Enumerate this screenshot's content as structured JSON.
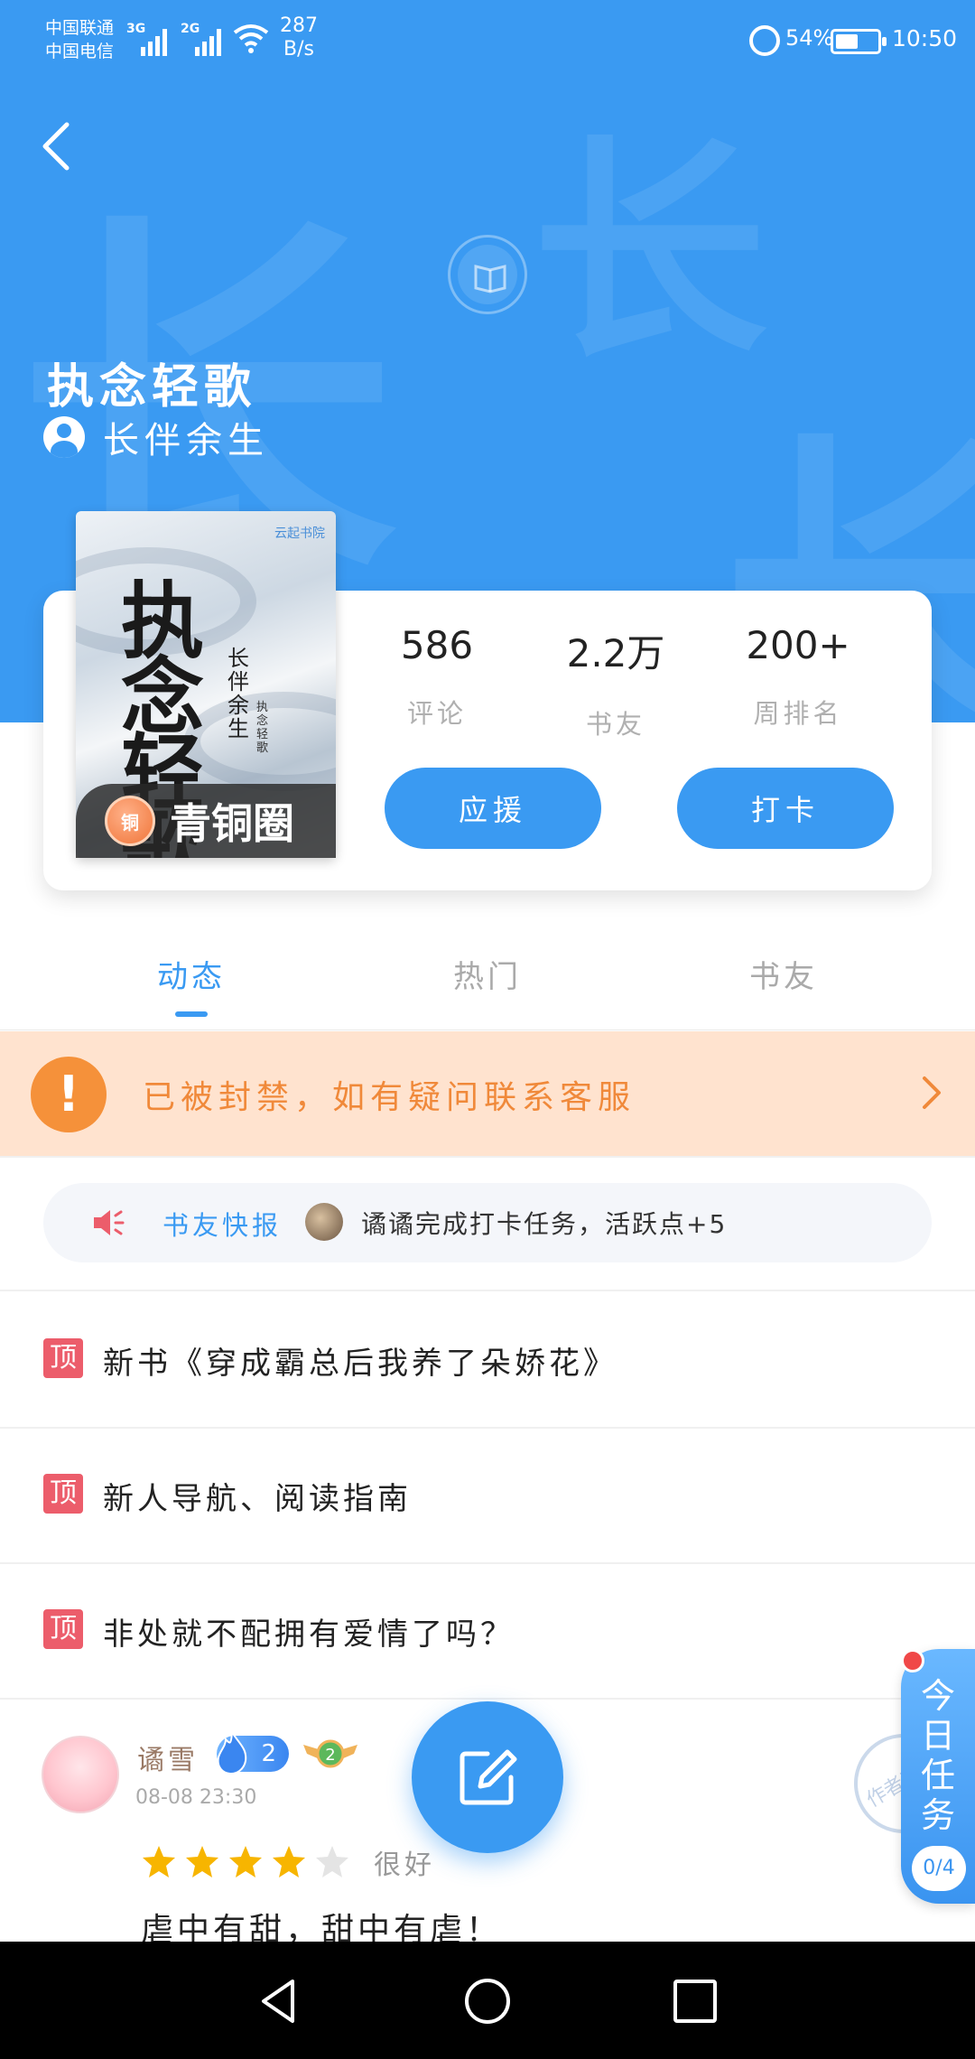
{
  "status_bar": {
    "carrier_1": "中国联通",
    "carrier_2": "中国电信",
    "signal_1": "3G",
    "signal_2": "2G",
    "net_speed_value": "287",
    "net_speed_unit": "B/s",
    "battery": "54%",
    "battery_level": 0.54,
    "time": "10:50"
  },
  "header": {
    "book_title": "执念轻歌",
    "author": "长伴余生",
    "bg_glyph": "长"
  },
  "cover": {
    "title": "执念轻歌",
    "author": "长伴余生",
    "logo": "云起书院",
    "small_text": "执念轻歌",
    "tier_icon_label": "铜",
    "tier_label": "青铜圈"
  },
  "stats": [
    {
      "value": "586",
      "label": "评论"
    },
    {
      "value": "2.2万",
      "label": "书友"
    },
    {
      "value": "200+",
      "label": "周排名"
    }
  ],
  "actions": {
    "support_label": "应援",
    "checkin_label": "打卡"
  },
  "tabs": [
    {
      "label": "动态",
      "active": true
    },
    {
      "label": "热门",
      "active": false
    },
    {
      "label": "书友",
      "active": false
    }
  ],
  "ban_notice": {
    "icon": "!",
    "text": "已被封禁，如有疑问联系客服"
  },
  "news": {
    "label": "书友快报",
    "text": "谲谲完成打卡任务，活跃点+5"
  },
  "pinned": [
    {
      "tag": "顶",
      "title": "新书《穿成霸总后我养了朵娇花》"
    },
    {
      "tag": "顶",
      "title": "新人导航、阅读指南"
    },
    {
      "tag": "顶",
      "title": "非处就不配拥有爱情了吗？"
    }
  ],
  "post": {
    "username": "谲雪",
    "fire_level": "2",
    "badge_level": "2",
    "time": "08-08 23:30",
    "stamp": "作者已阅",
    "rating": 4,
    "rating_max": 5,
    "rating_label": "很好",
    "body": "虐中有甜，甜中有虐！"
  },
  "task_widget": {
    "label": "今日任务",
    "count": "0/4"
  },
  "colors": {
    "accent": "#3a9af2",
    "ban_bg": "#ffe3cf",
    "ban_text": "#f0893a",
    "pin_tag": "#ec5d6b",
    "star": "#f7b500"
  },
  "icons": {
    "back": "chevron-left-icon",
    "book": "open-book-icon",
    "speaker": "speaker-icon",
    "edit": "edit-icon",
    "alarm": "alarm-icon"
  }
}
